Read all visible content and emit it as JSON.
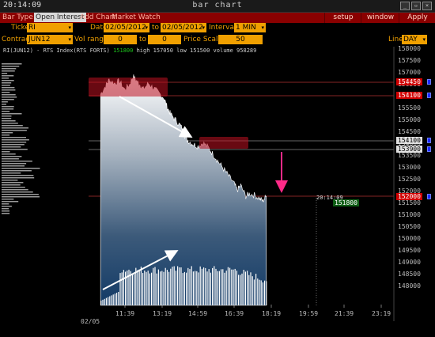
{
  "window": {
    "clock": "20:14:09",
    "title": "bar chart"
  },
  "menu": {
    "items": [
      "Bar Type",
      "Open Interest",
      "Add Chart",
      "Market Watch"
    ],
    "active": "Open Interest",
    "right_buttons": [
      "setup",
      "window",
      "Apply"
    ]
  },
  "toolbar": {
    "ticker_label": "Ticker",
    "ticker_value": "RI",
    "date_label": "Date",
    "date_from": "02/05/2012",
    "date_to_label": "to",
    "date_to": "02/05/2012",
    "interval_label": "Interval",
    "interval_value": "1 MIN",
    "contract_label": "Contract",
    "contract_value": "JUN12",
    "vol_range_label": "Vol range",
    "vol_from": "0",
    "vol_to_label": "to",
    "vol_to": "0",
    "price_scale_label": "Price Scale",
    "price_scale_value": "50",
    "line_label": "Line",
    "line_value": "DAY"
  },
  "chart_info": {
    "symbol": "RI(JUN12) - RTS Index(RTS FORTS)",
    "last": "151800",
    "high_text": "high 157050",
    "low_text": "low 151500",
    "volume_text": "volume 958289"
  },
  "price_tags": {
    "red_top": "154450",
    "red_second": "154100",
    "white_top": "154100",
    "white_second": "153900",
    "red_bottom": "152000"
  },
  "cursor": {
    "time": "20:14:09",
    "price": "151800"
  },
  "colors": {
    "menu_bg": "#8a0000",
    "field_orange": "#f0a000",
    "price_red": "#d00000",
    "last_green": "#1dc41d",
    "arrow_pink": "#ff2a88"
  },
  "chart_data": {
    "type": "area",
    "y_ticks": [
      "158000",
      "157500",
      "157000",
      "156500",
      "156000",
      "155500",
      "155000",
      "154500",
      "154000",
      "153500",
      "153000",
      "152500",
      "152000",
      "151500",
      "151000",
      "150500",
      "150000",
      "149500",
      "149000",
      "148500",
      "148000"
    ],
    "x_ticks": [
      "11:39",
      "13:19",
      "14:59",
      "16:39",
      "18:19",
      "19:59",
      "21:39",
      "23:19"
    ],
    "date_label": "02/05",
    "ylim": [
      147750,
      158100
    ],
    "price_series": [
      [
        10.5,
        156100
      ],
      [
        10.8,
        156450
      ],
      [
        11.0,
        156700
      ],
      [
        11.3,
        156550
      ],
      [
        11.6,
        156650
      ],
      [
        11.9,
        156300
      ],
      [
        12.2,
        156500
      ],
      [
        12.4,
        156850
      ],
      [
        12.6,
        156650
      ],
      [
        12.8,
        156500
      ],
      [
        13.0,
        156300
      ],
      [
        13.3,
        156550
      ],
      [
        13.6,
        156350
      ],
      [
        13.9,
        156150
      ],
      [
        14.2,
        155950
      ],
      [
        14.4,
        155550
      ],
      [
        14.6,
        155250
      ],
      [
        14.9,
        155000
      ],
      [
        15.2,
        154750
      ],
      [
        15.4,
        154400
      ],
      [
        15.6,
        154150
      ],
      [
        15.9,
        154000
      ],
      [
        16.2,
        153900
      ],
      [
        16.5,
        154050
      ],
      [
        16.8,
        153850
      ],
      [
        17.1,
        153550
      ],
      [
        17.4,
        153250
      ],
      [
        17.7,
        152950
      ],
      [
        18.0,
        152650
      ],
      [
        18.3,
        152350
      ],
      [
        18.5,
        152050
      ],
      [
        18.7,
        152250
      ],
      [
        19.0,
        151800
      ],
      [
        19.2,
        151900
      ],
      [
        19.5,
        151850
      ],
      [
        19.8,
        151700
      ],
      [
        20.0,
        151600
      ],
      [
        20.2,
        151800
      ]
    ],
    "volume_profile_note": "volume bars along the left edge"
  }
}
